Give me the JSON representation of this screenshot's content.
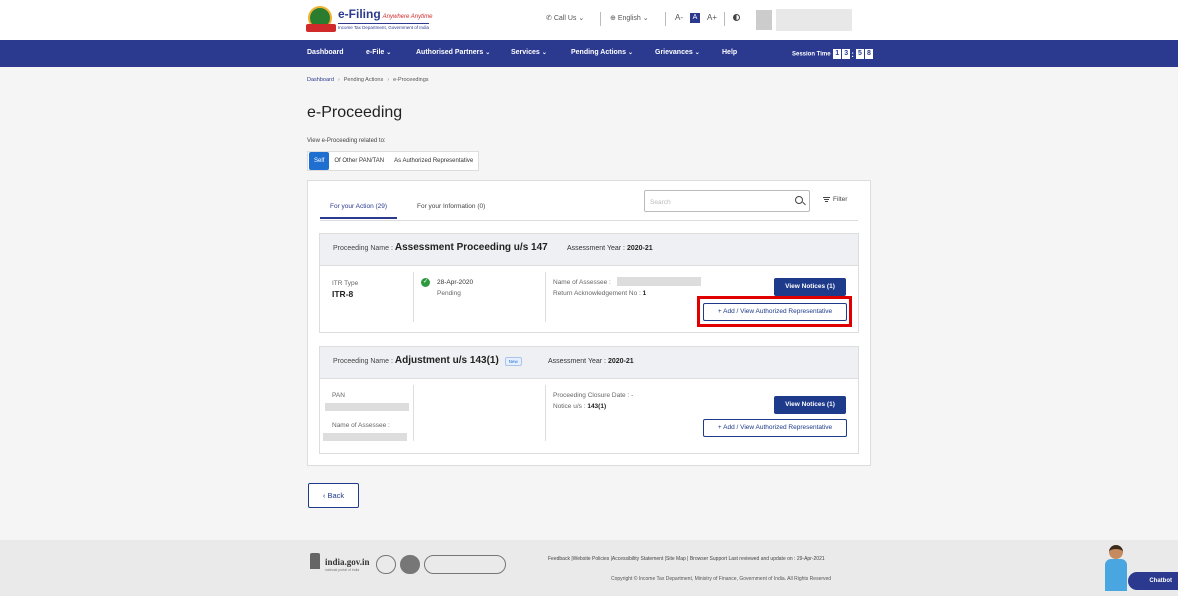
{
  "header": {
    "logo_title": "e-Filing",
    "logo_tagline": "Anywhere Anytime",
    "logo_subtitle": "Income Tax Department, Government of India",
    "call_us": "Call Us",
    "language": "English",
    "font_decrease": "A-",
    "font_normal": "A",
    "font_increase": "A+"
  },
  "nav": {
    "items": [
      {
        "label": "Dashboard",
        "dropdown": false
      },
      {
        "label": "e-File",
        "dropdown": true
      },
      {
        "label": "Authorised Partners",
        "dropdown": true
      },
      {
        "label": "Services",
        "dropdown": true
      },
      {
        "label": "Pending Actions",
        "dropdown": true
      },
      {
        "label": "Grievances",
        "dropdown": true
      },
      {
        "label": "Help",
        "dropdown": false
      }
    ],
    "session_label": "Session Time",
    "session_digits": [
      "1",
      "3",
      "5",
      "8"
    ]
  },
  "breadcrumb": [
    "Dashboard",
    "Pending Actions",
    "e-Proceedings"
  ],
  "page": {
    "title": "e-Proceeding",
    "view_label": "View e-Proceeding related to:",
    "segments": [
      "Self",
      "Of Other PAN/TAN",
      "As Authorized Representative"
    ],
    "active_segment": "Self"
  },
  "card": {
    "tabs": [
      "For your Action (29)",
      "For your Information (0)"
    ],
    "search_placeholder": "Search",
    "filter_label": "Filter"
  },
  "proceedings": [
    {
      "name_label": "Proceeding Name :",
      "name": "Assessment Proceeding u/s 147",
      "year_label": "Assessment Year :",
      "year": "2020-21",
      "itr_type_label": "ITR Type",
      "itr_type": "ITR-8",
      "date": "28-Apr-2020",
      "status": "Pending",
      "assessee_label": "Name of Assessee :",
      "ack_label": "Return Acknowledgement No :",
      "ack_no": "1",
      "view_notices": "View Notices (1)",
      "add_rep": "+ Add / View Authorized Representative"
    },
    {
      "name_label": "Proceeding Name :",
      "name": "Adjustment u/s 143(1)",
      "badge": "New",
      "year_label": "Assessment Year :",
      "year": "2020-21",
      "pan_label": "PAN",
      "assessee_label": "Name of Assessee :",
      "closure_label": "Proceeding Closure Date :",
      "closure_value": "-",
      "notice_label": "Notice u/s :",
      "notice_value": "143(1)",
      "view_notices": "View Notices (1)",
      "add_rep": "+ Add / View Authorized Representative"
    }
  ],
  "back_label": "Back",
  "footer": {
    "india_gov": "india.gov.in",
    "india_gov_sub": "national portal of india",
    "links": "Feedback |Website Policies |Accessibility Statement |Site Map | Browser Support   Last reviewed and update on : 29-Apr-2021",
    "copyright": "Copyright © Income Tax Department, Ministry of Finance, Government of India. All Rights Reserved",
    "chatbot": "Chatbot"
  },
  "colors": {
    "primary": "#2b3a8f",
    "accent_blue": "#1f6fd0",
    "highlight": "#e00000",
    "success": "#2e9a3f"
  }
}
